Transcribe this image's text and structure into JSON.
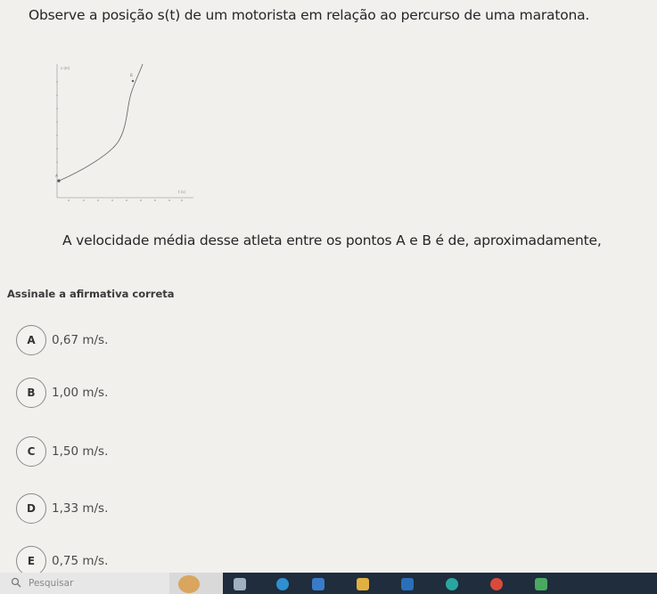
{
  "question": {
    "text": "Observe a posição s(t) de um motorista em relação ao percurso de uma maratona.",
    "statement": "A velocidade média desse atleta entre os pontos A e B é de, aproximadamente,"
  },
  "graph": {
    "y_axis_label": "s (m)",
    "x_axis_label": "t (s)",
    "point_a_label": "A",
    "point_b_label": "B"
  },
  "instruction": "Assinale a afirmativa correta",
  "options": [
    {
      "letter": "A",
      "text": "0,67 m/s."
    },
    {
      "letter": "B",
      "text": "1,00 m/s."
    },
    {
      "letter": "C",
      "text": "1,50 m/s."
    },
    {
      "letter": "D",
      "text": "1,33 m/s."
    },
    {
      "letter": "E",
      "text": "0,75 m/s."
    }
  ],
  "taskbar": {
    "search_placeholder": "Pesquisar"
  },
  "colors": {
    "background": "#f2f0ed",
    "taskbar_dark": "#1f2d3d",
    "curve": "#6d6d6d"
  }
}
